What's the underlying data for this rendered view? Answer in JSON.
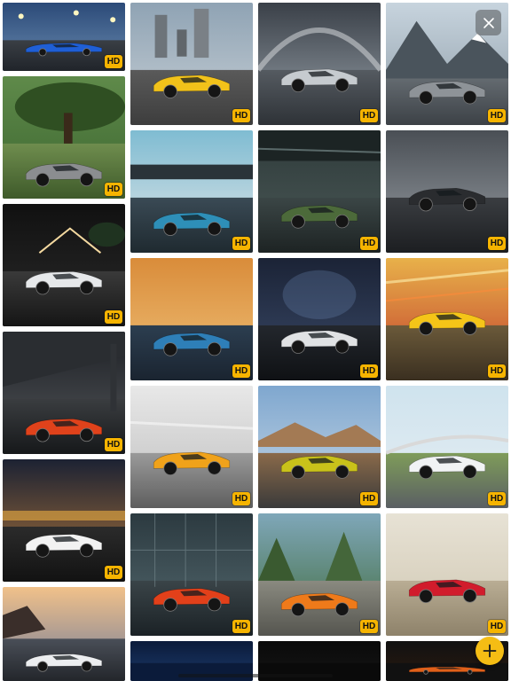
{
  "badge_label": "HD",
  "accent_color": "#f6b400",
  "close_button": {
    "icon": "close-icon",
    "glyph": "✕"
  },
  "add_button": {
    "icon": "plus-icon",
    "glyph": "+"
  },
  "wallpapers": [
    {
      "name": "blue-lamborghini-night-road",
      "hd": true
    },
    {
      "name": "yellow-lamborghini-industrial",
      "hd": true
    },
    {
      "name": "silver-huracan-tunnel",
      "hd": true
    },
    {
      "name": "grey-veneno-mountains",
      "hd": true
    },
    {
      "name": "veneno-garden",
      "hd": true
    },
    {
      "name": "teal-sian-roadster",
      "hd": true
    },
    {
      "name": "green-sian-hangar",
      "hd": true
    },
    {
      "name": "black-aventador-clouds",
      "hd": true
    },
    {
      "name": "white-huracan-palms-night",
      "hd": true
    },
    {
      "name": "blue-orange-huracan-sunset",
      "hd": true
    },
    {
      "name": "white-aventador-dark-studio",
      "hd": true
    },
    {
      "name": "yellow-aventador-speed",
      "hd": true
    },
    {
      "name": "orange-aventador-bridge",
      "hd": true
    },
    {
      "name": "orange-murcielago-motion",
      "hd": true
    },
    {
      "name": "yellow-huracan-evo-desert",
      "hd": true
    },
    {
      "name": "white-aventador-track",
      "hd": true
    },
    {
      "name": "white-gallardo-city-lights",
      "hd": true
    },
    {
      "name": "red-huracan-glass-building",
      "hd": true
    },
    {
      "name": "orange-gallardo-autumn",
      "hd": true
    },
    {
      "name": "red-aventador-beach",
      "hd": true
    },
    {
      "name": "white-lamborghini-coast",
      "hd": false
    },
    {
      "name": "dark-night-sky",
      "hd": false
    },
    {
      "name": "black-studio",
      "hd": false
    },
    {
      "name": "orange-car-sunset",
      "hd": false
    }
  ]
}
